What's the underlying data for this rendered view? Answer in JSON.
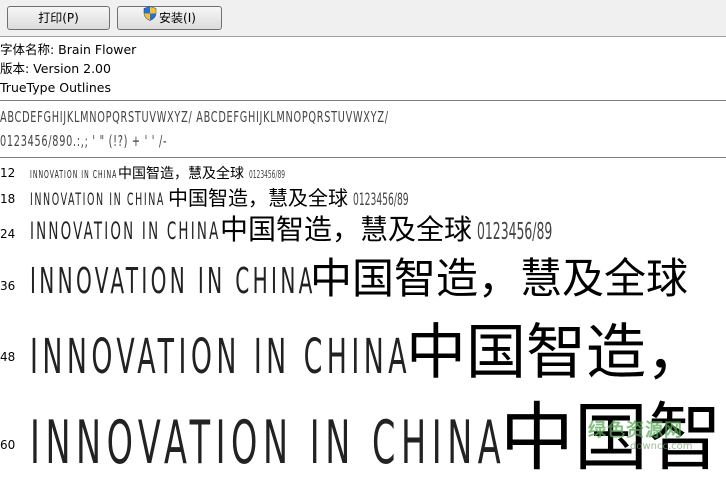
{
  "toolbar": {
    "print_label": "打印(P)",
    "install_label": "安装(I)"
  },
  "info": {
    "name_line": "字体名称: Brain Flower",
    "version_line": "版本: Version 2.00",
    "type_line": "TrueType Outlines"
  },
  "glyphs": {
    "upper_row": "ABCDEFGHIJKLMNOPQRSTUVWXYZ/ ABCDEFGHIJKLMNOPQRSTUVWXYZ/",
    "digits_row": "0123456/890.:,; ' \" (!?) + ' ' /-"
  },
  "samples": [
    {
      "size": "12",
      "latin": "INNOVATION IN CHINA",
      "cjk": "中国智造，慧及全球",
      "digits": "0123456/89"
    },
    {
      "size": "18",
      "latin": "INNOVATION IN CHINA",
      "cjk": "中国智造，慧及全球",
      "digits": "0123456/89"
    },
    {
      "size": "24",
      "latin": "INNOVATION IN CHINA",
      "cjk": "中国智造，慧及全球",
      "digits": "0123456/89"
    },
    {
      "size": "36",
      "latin": "INNOVATION IN CHINA",
      "cjk": "中国智造，慧及全球",
      "digits": ""
    },
    {
      "size": "48",
      "latin": "INNOVATION IN CHINA",
      "cjk": "中国智造，",
      "digits": ""
    },
    {
      "size": "60",
      "latin": "INNOVATION IN CHINA",
      "cjk": "中国智",
      "digits": ""
    }
  ],
  "watermark": {
    "text": "绿色资源网",
    "url": "downcc.com",
    "color": "#5aaa5a"
  },
  "icons": {
    "install": "uac-shield-icon"
  }
}
